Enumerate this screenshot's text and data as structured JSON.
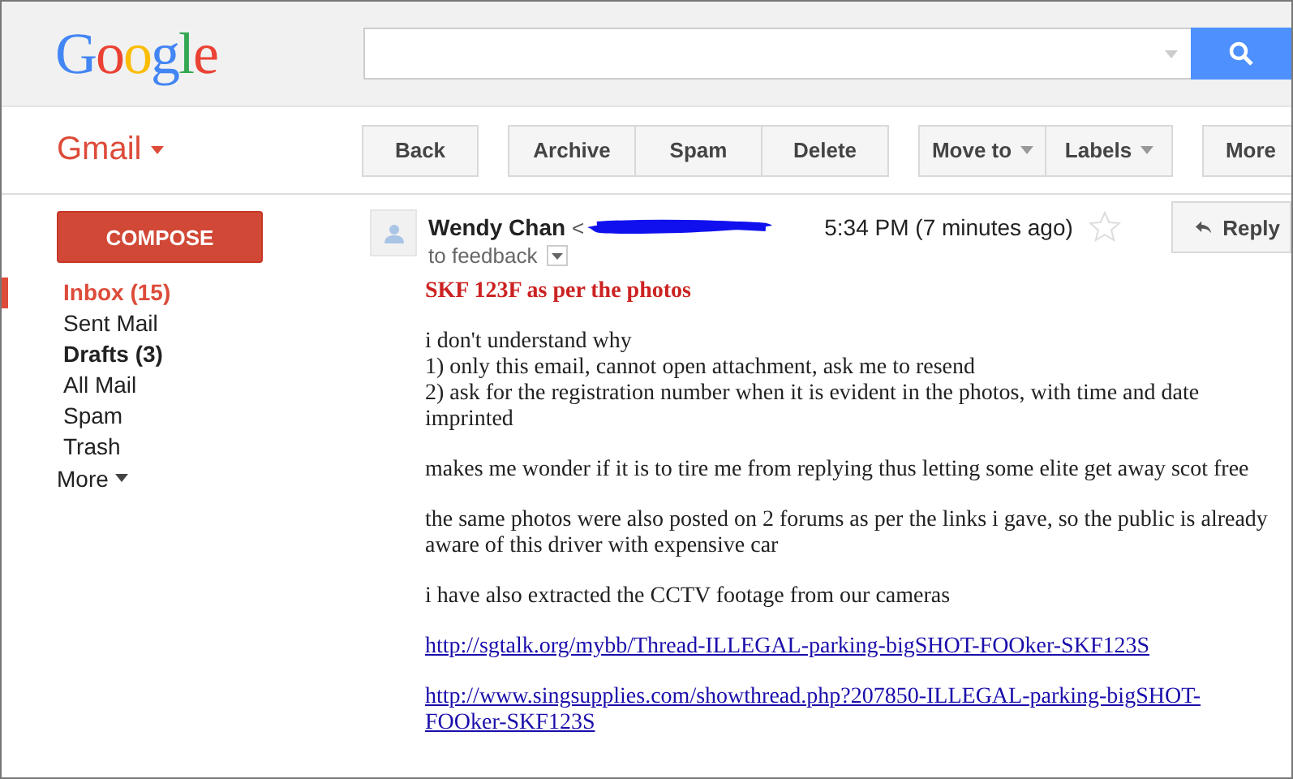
{
  "logo": "Google",
  "app_menu": {
    "label": "Gmail"
  },
  "toolbar": [
    {
      "buttons": [
        {
          "label": "Back",
          "dropdown": false
        }
      ]
    },
    {
      "buttons": [
        {
          "label": "Archive",
          "dropdown": false
        },
        {
          "label": "Spam",
          "dropdown": false
        },
        {
          "label": "Delete",
          "dropdown": false
        }
      ]
    },
    {
      "buttons": [
        {
          "label": "Move to",
          "dropdown": true
        },
        {
          "label": "Labels",
          "dropdown": true
        }
      ]
    },
    {
      "buttons": [
        {
          "label": "More",
          "dropdown": false
        }
      ]
    }
  ],
  "compose": "COMPOSE",
  "sidebar": {
    "items": [
      {
        "label": "Inbox (15)",
        "selected": true,
        "bold": true
      },
      {
        "label": "Sent Mail",
        "selected": false,
        "bold": false
      },
      {
        "label": "Drafts (3)",
        "selected": false,
        "bold": true
      },
      {
        "label": "All Mail",
        "selected": false,
        "bold": false
      },
      {
        "label": "Spam",
        "selected": false,
        "bold": false
      },
      {
        "label": "Trash",
        "selected": false,
        "bold": false
      }
    ],
    "more": "More"
  },
  "message": {
    "sender": "Wendy Chan",
    "address_start": "<",
    "time": "5:34 PM (7 minutes ago)",
    "starred": false,
    "reply": "Reply",
    "recipients": "to feedback",
    "subject": "SKF 123F as per the photos",
    "paragraphs": [
      {
        "lines": [
          "i don't understand why",
          "1) only this email, cannot open attachment, ask me to resend",
          "2) ask for the registration number when it is evident in the photos, with time and date imprinted"
        ]
      },
      {
        "lines": [
          "makes me wonder if it is to tire me from replying thus letting some elite get away scot  free"
        ]
      },
      {
        "lines": [
          "the same photos were also posted on 2 forums as per the links i gave, so the public is already aware of this driver with expensive car"
        ]
      },
      {
        "lines": [
          "i have also extracted the CCTV footage from our cameras"
        ]
      },
      {
        "link": "http://sgtalk.org/mybb/Thread-ILLEGAL-parking-bigSHOT-FOOker-SKF123S"
      },
      {
        "link": "http://www.singsupplies.com/showthread.php?207850-ILLEGAL-parking-bigSHOT-FOOker-SKF123S"
      }
    ]
  }
}
